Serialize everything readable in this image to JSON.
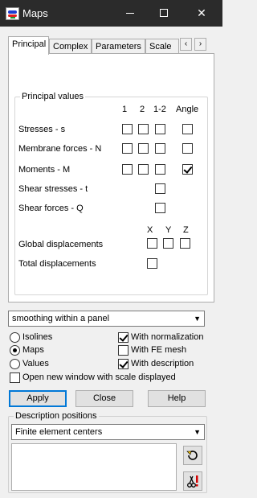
{
  "window": {
    "title": "Maps"
  },
  "tabs": [
    "Principal",
    "Complex",
    "Parameters",
    "Scale"
  ],
  "tab_scroll": {
    "left": "‹",
    "right": "›"
  },
  "principal_values": {
    "group_title": "Principal values",
    "col_headers": [
      "1",
      "2",
      "1-2",
      "Angle"
    ],
    "rows": [
      {
        "label": "Stresses - s"
      },
      {
        "label": "Membrane forces - N"
      },
      {
        "label": "Moments - M"
      },
      {
        "label": "Shear stresses - t"
      },
      {
        "label": "Shear forces - Q"
      }
    ]
  },
  "displacements": {
    "col_headers": [
      "X",
      "Y",
      "Z"
    ],
    "global_label": "Global displacements",
    "total_label": "Total displacements"
  },
  "smoothing_select": {
    "value": "smoothing within a panel"
  },
  "display_mode": {
    "isolines": "Isolines",
    "maps": "Maps",
    "values": "Values",
    "selected": "Maps"
  },
  "options": {
    "with_normalization": "With normalization",
    "with_fe_mesh": "With FE mesh",
    "with_description": "With description",
    "open_new_window": "Open new window with scale displayed"
  },
  "buttons": {
    "apply": "Apply",
    "close": "Close",
    "help": "Help"
  },
  "description_positions": {
    "group_title": "Description positions",
    "select_value": "Finite element centers"
  }
}
